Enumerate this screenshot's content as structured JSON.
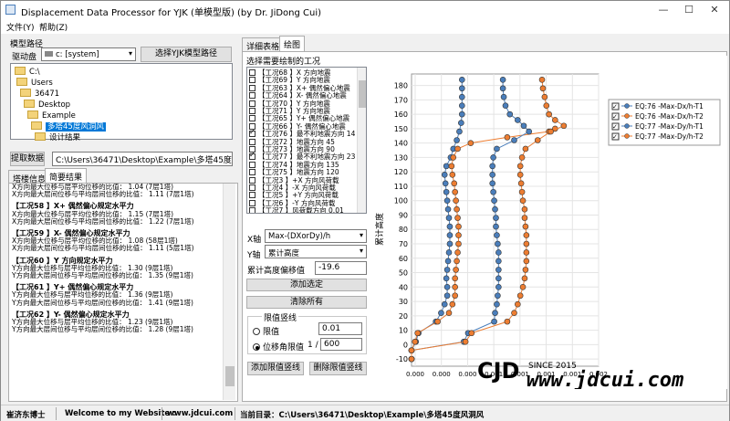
{
  "window": {
    "title": "Displacement Data Processor for YJK (单模型版) (by Dr. JiDong Cui)",
    "controls": {
      "minimize": "—",
      "maximize": "☐",
      "close": "✕"
    }
  },
  "menu": {
    "file": "文件(Y)",
    "help": "帮助(Z)"
  },
  "left": {
    "path_group": "模型路径",
    "drive_label": "驱动盘",
    "drive_value": "c: [system]",
    "select_btn": "选择YJK模型路径",
    "tree": [
      "C:\\",
      "Users",
      "36471",
      "Desktop",
      "Example",
      "多塔45度风洞风",
      "设计结果"
    ],
    "extract_btn": "提取数据",
    "path_value": "C:\\Users\\36471\\Desktop\\Example\\多塔45度风洞风",
    "tabs": [
      "塔楼信息",
      "简要结果"
    ],
    "results": [
      {
        "h": "",
        "lines": [
          "X方向最大位移与层平均位移的比值：  1.04 (7层1塔)",
          "X方向最大层间位移与平均层间位移的比值：  1.11 (7层1塔)"
        ]
      },
      {
        "h": "【工况58 】X+ 偶然偏心规定水平力",
        "lines": [
          "X方向最大位移与层平均位移的比值：  1.15 (7层1塔)",
          "X方向最大层间位移与平均层间位移的比值：  1.22 (7层1塔)"
        ]
      },
      {
        "h": "【工况59 】X- 偶然偏心规定水平力",
        "lines": [
          "X方向最大位移与层平均位移的比值：  1.08 (58层1塔)",
          "X方向最大层间位移与平均层间位移的比值：  1.11 (5层1塔)"
        ]
      },
      {
        "h": "【工况60 】Y 方向规定水平力",
        "lines": [
          "Y方向最大位移与层平均位移的比值：  1.30 (9层1塔)",
          "Y方向最大层间位移与平均层间位移的比值：  1.35 (9层1塔)"
        ]
      },
      {
        "h": "【工况61 】Y+ 偶然偏心规定水平力",
        "lines": [
          "Y方向最大位移与层平均位移的比值：  1.36 (9层1塔)",
          "Y方向最大层间位移与平均层间位移的比值：  1.41 (9层1塔)"
        ]
      },
      {
        "h": "【工况62 】Y- 偶然偏心规定水平力",
        "lines": [
          "Y方向最大位移与层平均位移的比值：  1.23 (9层1塔)",
          "Y方向最大层间位移与平均层间位移的比值：  1.28 (9层1塔)"
        ]
      }
    ]
  },
  "right": {
    "tabs": [
      "详细表格",
      "绘图"
    ],
    "select_label": "选择需要绘制的工况",
    "load_cases": [
      {
        "text": "【工况68 】X 方向地震",
        "on": false
      },
      {
        "text": "【工况69 】Y 方向地震",
        "on": false
      },
      {
        "text": "【工况63 】X+ 偶然偏心地震",
        "on": false
      },
      {
        "text": "【工况64 】X- 偶然偏心地震",
        "on": false
      },
      {
        "text": "【工况70 】Y 方向地震",
        "on": false
      },
      {
        "text": "【工况71 】Y 方向地震",
        "on": false
      },
      {
        "text": "【工况65 】Y+ 偶然偏心地震",
        "on": false
      },
      {
        "text": "【工况66 】Y- 偶然偏心地震",
        "on": false
      },
      {
        "text": "【工况76 】最不利地震方向 14",
        "on": true
      },
      {
        "text": "【工况72 】地震方向 45",
        "on": false
      },
      {
        "text": "【工况73 】地震方向 90",
        "on": false
      },
      {
        "text": "【工况77 】最不利地震方向 23",
        "on": true
      },
      {
        "text": "【工况74 】地震方向 135",
        "on": false
      },
      {
        "text": "【工况75 】地震方向 120",
        "on": false
      },
      {
        "text": "【工况3 】+X 方向风荷载",
        "on": false
      },
      {
        "text": "【工况4 】-X 方向风荷载",
        "on": false
      },
      {
        "text": "【工况5 】+Y 方向风荷载",
        "on": false
      },
      {
        "text": "【工况6 】-Y 方向风荷载",
        "on": false
      },
      {
        "text": "【工况7 】风荷载方向 0.01",
        "on": false
      }
    ],
    "x_axis_label": "X轴",
    "x_axis_value": "Max-(DXorDy)/h",
    "y_axis_label": "Y轴",
    "y_axis_value": "累计高度",
    "offset_label": "累计高度偏移值",
    "offset_value": "-19.6",
    "add_btn": "添加选定",
    "clear_btn": "清除所有",
    "limit_group": "限值竖线",
    "limit_opt1": "限值",
    "limit_val1": "0.01",
    "limit_opt2": "位移角限值",
    "limit_prefix": "1 /",
    "limit_val2": "600",
    "add_limit_btn": "添加限值竖线",
    "del_limit_btn": "删除限值竖线"
  },
  "chart_data": {
    "type": "scatter",
    "ylabel": "累计高度",
    "yticks": [
      -10,
      0,
      10,
      20,
      30,
      40,
      50,
      60,
      70,
      80,
      90,
      100,
      110,
      120,
      130,
      140,
      150,
      160,
      170,
      180
    ],
    "ylim": [
      -15,
      188
    ],
    "xticks": [
      "0.000",
      "0.000",
      "0.000",
      "0.001",
      "0.001",
      "0.001",
      "0.001",
      "0.002"
    ],
    "xlim": [
      0,
      0.00215
    ],
    "series": [
      {
        "name": "EQ:76 -Max-Dx/h-T1",
        "color": "#4a7ebb",
        "points": [
          [
            0.0,
            -10
          ],
          [
            0.0,
            -4
          ],
          [
            5e-05,
            2
          ],
          [
            8e-05,
            8
          ],
          [
            0.00028,
            16
          ],
          [
            0.00034,
            22
          ],
          [
            0.00038,
            28
          ],
          [
            0.00041,
            34
          ],
          [
            0.00041,
            40
          ],
          [
            0.0004,
            46
          ],
          [
            0.00041,
            52
          ],
          [
            0.00042,
            58
          ],
          [
            0.00043,
            64
          ],
          [
            0.00044,
            70
          ],
          [
            0.00044,
            76
          ],
          [
            0.00044,
            82
          ],
          [
            0.00043,
            88
          ],
          [
            0.00042,
            94
          ],
          [
            0.00041,
            100
          ],
          [
            0.0004,
            106
          ],
          [
            0.00039,
            112
          ],
          [
            0.00038,
            118
          ],
          [
            0.0004,
            124
          ],
          [
            0.00045,
            130
          ],
          [
            0.00048,
            136
          ],
          [
            0.00052,
            142
          ],
          [
            0.00055,
            148
          ],
          [
            0.00057,
            154
          ],
          [
            0.00058,
            160
          ],
          [
            0.00058,
            166
          ],
          [
            0.00058,
            172
          ],
          [
            0.00058,
            178
          ],
          [
            0.00058,
            184
          ]
        ]
      },
      {
        "name": "EQ:76 -Max-Dx/h-T2",
        "color": "#ed7d31",
        "points": [
          [
            0.0,
            -10
          ],
          [
            0.0,
            -4
          ],
          [
            4e-05,
            2
          ],
          [
            7e-05,
            8
          ],
          [
            0.0003,
            16
          ],
          [
            0.00043,
            22
          ],
          [
            0.00047,
            28
          ],
          [
            0.0005,
            34
          ],
          [
            0.0005,
            40
          ],
          [
            0.0005,
            46
          ],
          [
            0.00051,
            52
          ],
          [
            0.00052,
            58
          ],
          [
            0.00053,
            64
          ],
          [
            0.00054,
            70
          ],
          [
            0.00054,
            76
          ],
          [
            0.00054,
            82
          ],
          [
            0.00053,
            88
          ],
          [
            0.00052,
            94
          ],
          [
            0.00051,
            100
          ],
          [
            0.0005,
            106
          ],
          [
            0.00049,
            112
          ],
          [
            0.00047,
            118
          ],
          [
            0.00046,
            124
          ],
          [
            0.00048,
            130
          ],
          [
            0.00053,
            136
          ],
          [
            0.00068,
            140
          ],
          [
            0.0011,
            144
          ],
          [
            0.00158,
            148
          ],
          [
            0.00165,
            150
          ]
        ]
      },
      {
        "name": "EQ:77 -Max-Dy/h-T1",
        "color": "#4a7ebb",
        "points": [
          [
            0.0,
            -10
          ],
          [
            0.0,
            -4
          ],
          [
            0.0006,
            2
          ],
          [
            0.00065,
            8
          ],
          [
            0.00095,
            16
          ],
          [
            0.00096,
            22
          ],
          [
            0.00098,
            28
          ],
          [
            0.00099,
            34
          ],
          [
            0.001,
            40
          ],
          [
            0.001,
            46
          ],
          [
            0.001,
            52
          ],
          [
            0.001,
            58
          ],
          [
            0.001,
            64
          ],
          [
            0.00099,
            70
          ],
          [
            0.00098,
            76
          ],
          [
            0.00097,
            82
          ],
          [
            0.00097,
            88
          ],
          [
            0.00096,
            94
          ],
          [
            0.00095,
            100
          ],
          [
            0.00094,
            106
          ],
          [
            0.00093,
            112
          ],
          [
            0.00093,
            118
          ],
          [
            0.00093,
            124
          ],
          [
            0.00094,
            130
          ],
          [
            0.00098,
            136
          ],
          [
            0.00118,
            142
          ],
          [
            0.00135,
            148
          ],
          [
            0.00129,
            152
          ],
          [
            0.00122,
            156
          ],
          [
            0.00113,
            160
          ],
          [
            0.00108,
            166
          ],
          [
            0.00106,
            172
          ],
          [
            0.00105,
            178
          ],
          [
            0.00105,
            184
          ]
        ]
      },
      {
        "name": "EQ:77 -Max-Dy/h-T2",
        "color": "#ed7d31",
        "points": [
          [
            0.0,
            -10
          ],
          [
            0.0,
            -4
          ],
          [
            0.00062,
            2
          ],
          [
            0.00069,
            8
          ],
          [
            0.0011,
            16
          ],
          [
            0.00118,
            22
          ],
          [
            0.00122,
            28
          ],
          [
            0.00125,
            34
          ],
          [
            0.00128,
            40
          ],
          [
            0.0013,
            46
          ],
          [
            0.00131,
            52
          ],
          [
            0.00132,
            58
          ],
          [
            0.00132,
            64
          ],
          [
            0.00132,
            70
          ],
          [
            0.00132,
            76
          ],
          [
            0.00131,
            82
          ],
          [
            0.0013,
            88
          ],
          [
            0.0013,
            94
          ],
          [
            0.00128,
            100
          ],
          [
            0.00127,
            106
          ],
          [
            0.00126,
            112
          ],
          [
            0.00125,
            118
          ],
          [
            0.00125,
            124
          ],
          [
            0.00127,
            130
          ],
          [
            0.00131,
            136
          ],
          [
            0.00145,
            142
          ],
          [
            0.0016,
            148
          ],
          [
            0.00175,
            152
          ],
          [
            0.00165,
            156
          ],
          [
            0.00158,
            160
          ],
          [
            0.00155,
            166
          ],
          [
            0.00153,
            172
          ],
          [
            0.00151,
            178
          ],
          [
            0.0015,
            184
          ]
        ]
      }
    ],
    "legend": "top-right"
  },
  "status": {
    "author": "崔济东博士",
    "welcome": "Welcome to my Website :",
    "site": "www.jdcui.com",
    "dir_label": "当前目录：C:\\Users\\36471\\Desktop\\Example\\多塔45度风洞风"
  },
  "watermark": {
    "logo": "CJD",
    "since": "SINCE 2015",
    "url": "www.jdcui.com"
  }
}
